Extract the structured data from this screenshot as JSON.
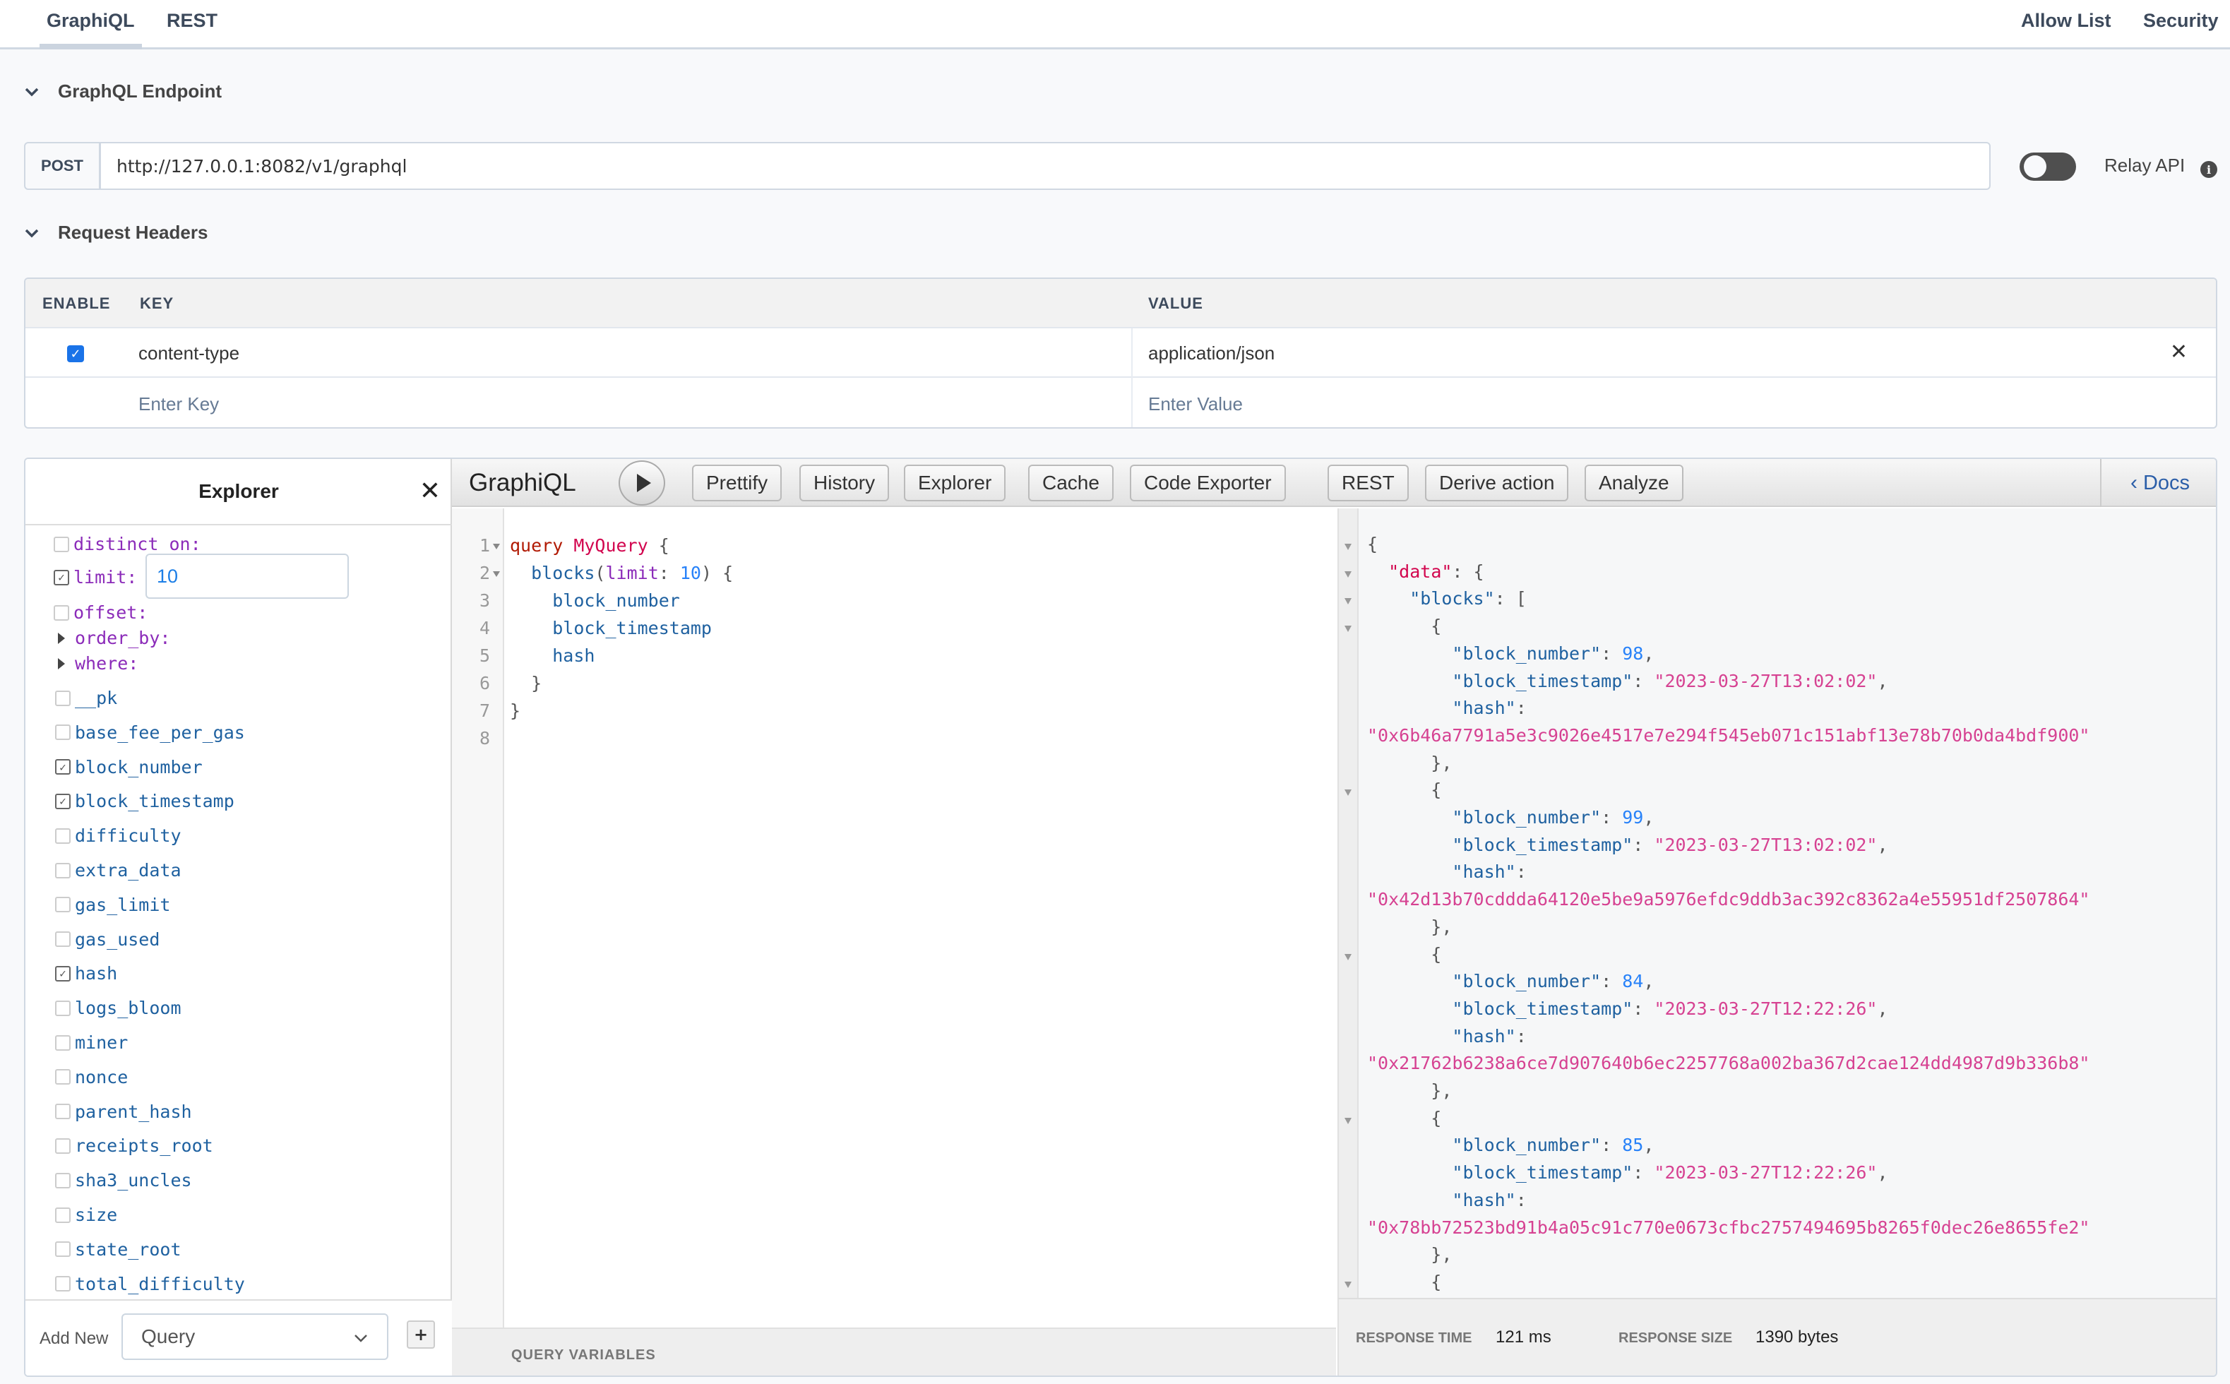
{
  "top_tabs": {
    "left": [
      {
        "label": "GraphiQL",
        "active": true
      },
      {
        "label": "REST",
        "active": false
      }
    ],
    "right": [
      {
        "label": "Allow List"
      },
      {
        "label": "Security"
      }
    ]
  },
  "endpoint": {
    "section_title": "GraphQL Endpoint",
    "method": "POST",
    "url": "http://127.0.0.1:8082/v1/graphql",
    "relay_label": "Relay API",
    "relay_enabled": false,
    "info_icon": "info-icon"
  },
  "request_headers": {
    "section_title": "Request Headers",
    "columns": [
      "ENABLE",
      "KEY",
      "VALUE"
    ],
    "rows": [
      {
        "enabled": true,
        "key": "content-type",
        "value": "application/json"
      }
    ],
    "new_row": {
      "key_placeholder": "Enter Key",
      "value_placeholder": "Enter Value"
    }
  },
  "explorer": {
    "title": "Explorer",
    "close_icon": "close-icon",
    "args": [
      {
        "name": "distinct_on:",
        "kind": "checkbox",
        "checked": false
      },
      {
        "name": "limit:",
        "kind": "checkbox",
        "checked": true,
        "value": "10"
      },
      {
        "name": "offset:",
        "kind": "checkbox",
        "checked": false
      },
      {
        "name": "order_by:",
        "kind": "expand"
      },
      {
        "name": "where:",
        "kind": "expand"
      }
    ],
    "fields": [
      {
        "name": "__pk",
        "checked": false
      },
      {
        "name": "base_fee_per_gas",
        "checked": false
      },
      {
        "name": "block_number",
        "checked": true
      },
      {
        "name": "block_timestamp",
        "checked": true
      },
      {
        "name": "difficulty",
        "checked": false
      },
      {
        "name": "extra_data",
        "checked": false
      },
      {
        "name": "gas_limit",
        "checked": false
      },
      {
        "name": "gas_used",
        "checked": false
      },
      {
        "name": "hash",
        "checked": true
      },
      {
        "name": "logs_bloom",
        "checked": false
      },
      {
        "name": "miner",
        "checked": false
      },
      {
        "name": "nonce",
        "checked": false
      },
      {
        "name": "parent_hash",
        "checked": false
      },
      {
        "name": "receipts_root",
        "checked": false
      },
      {
        "name": "sha3_uncles",
        "checked": false
      },
      {
        "name": "size",
        "checked": false
      },
      {
        "name": "state_root",
        "checked": false
      },
      {
        "name": "total_difficulty",
        "checked": false
      }
    ],
    "footer": {
      "add_new_label": "Add New",
      "operation_type": "Query",
      "add_button": "+"
    }
  },
  "toolbar": {
    "title": "GraphiQL",
    "buttons": [
      "Prettify",
      "History",
      "Explorer",
      "Cache",
      "Code Exporter",
      "REST",
      "Derive action",
      "Analyze"
    ],
    "docs_label": "Docs"
  },
  "query_editor": {
    "lines": [
      {
        "n": "1",
        "fold": true
      },
      {
        "n": "2",
        "fold": true
      },
      {
        "n": "3",
        "fold": false
      },
      {
        "n": "4",
        "fold": false
      },
      {
        "n": "5",
        "fold": false
      },
      {
        "n": "6",
        "fold": false
      },
      {
        "n": "7",
        "fold": false
      },
      {
        "n": "8",
        "fold": false
      }
    ],
    "tokens": {
      "keyword": "query",
      "operation_name": "MyQuery",
      "root_field": "blocks",
      "arg_name": "limit",
      "arg_value": "10",
      "fields": [
        "block_number",
        "block_timestamp",
        "hash"
      ]
    },
    "variables_label": "QUERY VARIABLES"
  },
  "result": {
    "root_key": "data",
    "list_key": "blocks",
    "blocks": [
      {
        "block_number": 98,
        "block_timestamp": "2023-03-27T13:02:02",
        "hash": "0x6b46a7791a5e3c9026e4517e7e294f545eb071c151abf13e78b70b0da4bdf900"
      },
      {
        "block_number": 99,
        "block_timestamp": "2023-03-27T13:02:02",
        "hash": "0x42d13b70cddda64120e5be9a5976efdc9ddb3ac392c8362a4e55951df2507864"
      },
      {
        "block_number": 84,
        "block_timestamp": "2023-03-27T12:22:26",
        "hash": "0x21762b6238a6ce7d907640b6ec2257768a002ba367d2cae124dd4987d9b336b8"
      },
      {
        "block_number": 85,
        "block_timestamp": "2023-03-27T12:22:26",
        "hash": "0x78bb72523bd91b4a05c91c770e0673cfbc2757494695b8265f0dec26e8655fe2"
      }
    ],
    "response_time_label": "RESPONSE TIME",
    "response_time": "121 ms",
    "response_size_label": "RESPONSE SIZE",
    "response_size": "1390 bytes"
  }
}
